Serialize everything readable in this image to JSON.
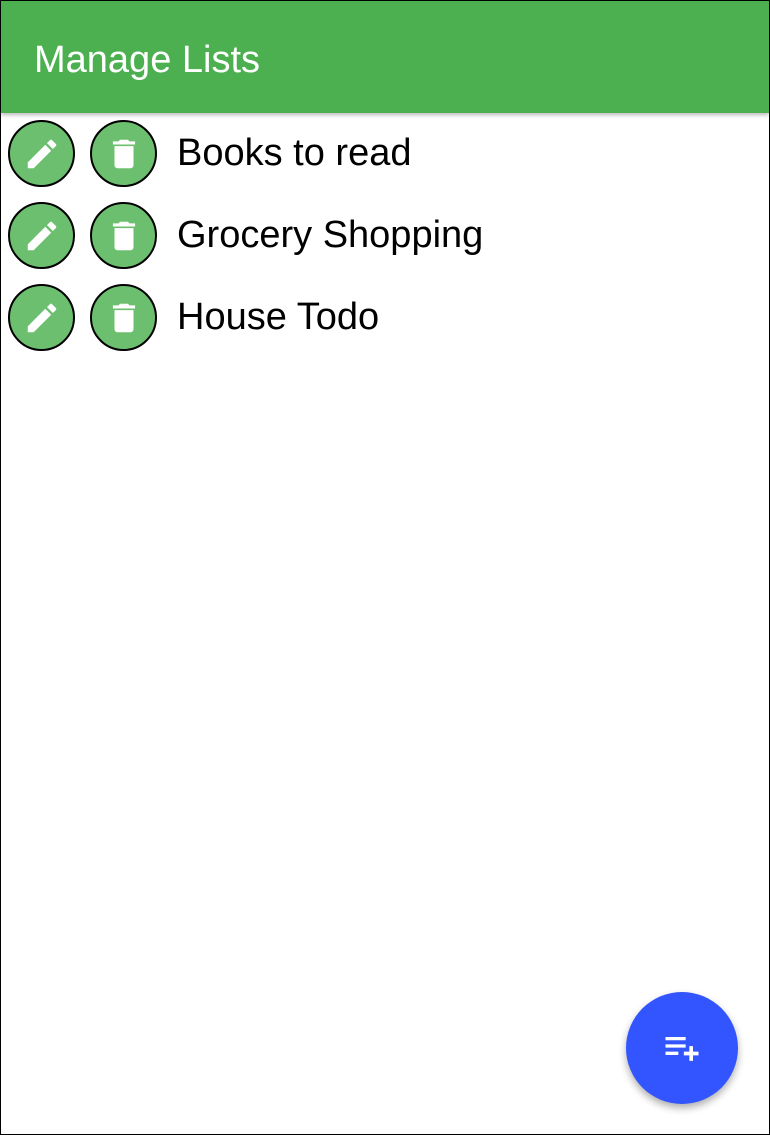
{
  "app_bar": {
    "title": "Manage Lists",
    "color": "#4caf50"
  },
  "lists": [
    {
      "name": "Books to read",
      "edit_icon": "pencil-icon",
      "delete_icon": "trash-icon"
    },
    {
      "name": "Grocery Shopping",
      "edit_icon": "pencil-icon",
      "delete_icon": "trash-icon"
    },
    {
      "name": "House Todo",
      "edit_icon": "pencil-icon",
      "delete_icon": "trash-icon"
    }
  ],
  "row_button_color": "#6cbf6e",
  "fab": {
    "icon": "playlist-add-icon",
    "color": "#3355ff"
  }
}
